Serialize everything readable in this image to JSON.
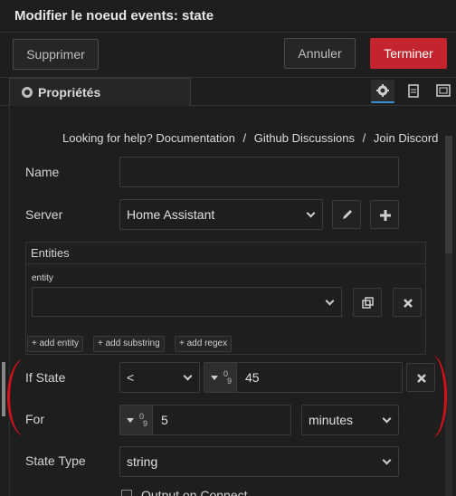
{
  "header": {
    "title": "Modifier le noeud events: state"
  },
  "actions": {
    "delete_label": "Supprimer",
    "cancel_label": "Annuler",
    "done_label": "Terminer"
  },
  "tabs": {
    "properties_label": "Propriétés"
  },
  "help": {
    "prefix": "Looking for help?",
    "links": [
      "Documentation",
      "Github Discussions",
      "Join Discord"
    ],
    "separator": "/"
  },
  "form": {
    "name": {
      "label": "Name",
      "value": ""
    },
    "server": {
      "label": "Server",
      "value": "Home Assistant"
    },
    "entities": {
      "title": "Entities",
      "subtitle": "entity",
      "value": "",
      "buttons": [
        "+ add entity",
        "+ add substring",
        "+ add regex"
      ]
    },
    "if_state": {
      "label": "If State",
      "operator": "<",
      "type_icon": "0/9",
      "value": "45"
    },
    "for": {
      "label": "For",
      "type_icon": "0/9",
      "value": "5",
      "unit": "minutes"
    },
    "state_type": {
      "label": "State Type",
      "value": "string"
    },
    "output_on_connect": {
      "label": "Output on Connect"
    }
  },
  "colors": {
    "accent_red": "#c3242d",
    "annotation_red": "#d4101a",
    "tab_active": "#3a8fd6"
  }
}
